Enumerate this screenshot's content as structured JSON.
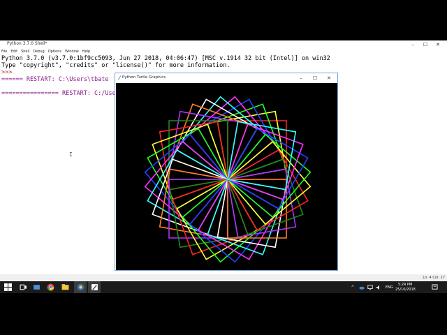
{
  "shell": {
    "title": "Python 3.7.0 Shell*",
    "menu": [
      "File",
      "Edit",
      "Shell",
      "Debug",
      "Options",
      "Window",
      "Help"
    ],
    "lines": [
      {
        "text": "Python 3.7.0 (v3.7.0:1bf9cc5093, Jun 27 2018, 04:06:47) [MSC v.1914 32 bit (Intel)] on win32",
        "kind": "normal"
      },
      {
        "text": "Type \"copyright\", \"credits\" or \"license()\" for more information.",
        "kind": "normal"
      },
      {
        "text": ">>>",
        "kind": "prompt"
      },
      {
        "text": "====== RESTART: C:\\Users\\tbate",
        "kind": "restart"
      },
      {
        "text": "",
        "kind": "normal"
      },
      {
        "text": "================ RESTART: C:/Use",
        "kind": "restart"
      }
    ],
    "status": "Ln: 4  Col: 17"
  },
  "turtle_window": {
    "title": "Python Turtle Graphics",
    "buttons": [
      "–",
      "☐",
      "✕"
    ],
    "colors": [
      "#ff2020",
      "#ffff30",
      "#20ff20",
      "#2040ff",
      "#ff30ff",
      "#30ffff",
      "#ffffff",
      "#ff8020",
      "#b030ff",
      "#1a8a1a"
    ]
  },
  "taskbar": {
    "language": "ENG",
    "time": "5:24 PM",
    "date": "25/10/2018"
  }
}
